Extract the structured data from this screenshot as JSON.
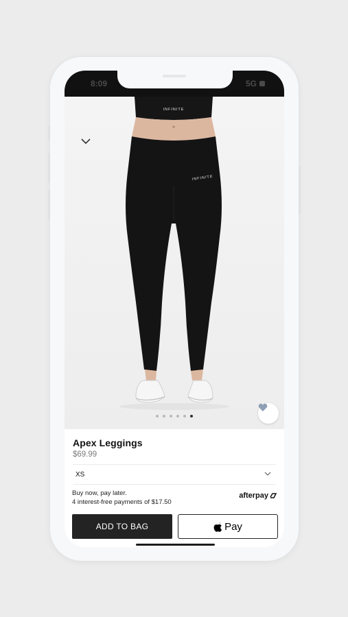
{
  "status_bar": {
    "time": "8:09",
    "network": "5G"
  },
  "product": {
    "title": "Apex Leggings",
    "price": "$69.99",
    "brand_print": "INFINITE",
    "image_page_count": 6,
    "image_page_active": 6
  },
  "size_selector": {
    "selected": "XS"
  },
  "payment": {
    "line1": "Buy now, pay later.",
    "line2": "4 interest-free payments of $17.50",
    "provider": "afterpay"
  },
  "actions": {
    "add_to_bag": "ADD TO BAG",
    "apple_pay": "Pay"
  },
  "icons": {
    "collapse": "chevron-down-icon",
    "favorite": "heart-icon",
    "size_chevron": "chevron-down-icon",
    "apple": "apple-logo-icon",
    "afterpay_logo": "afterpay-loop-icon"
  },
  "colors": {
    "primary_button": "#232323",
    "heart_icon": "#8ea0b6",
    "garment": "#141414"
  }
}
